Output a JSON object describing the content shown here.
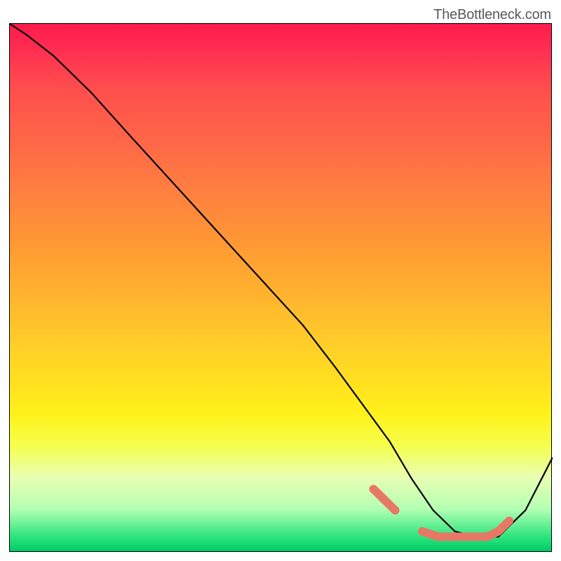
{
  "watermark": "TheBottleneck.com",
  "chart_data": {
    "type": "line",
    "title": "",
    "xlabel": "",
    "ylabel": "",
    "xlim": [
      0,
      100
    ],
    "ylim": [
      0,
      100
    ],
    "grid": false,
    "legend": false,
    "gradient_colors": {
      "top": "#ff1a4d",
      "mid_upper": "#ff8040",
      "mid": "#ffe01f",
      "mid_lower": "#e8ffb3",
      "bottom": "#00cc66"
    },
    "series": [
      {
        "name": "bottleneck-curve",
        "color": "#000000",
        "x": [
          0,
          3,
          8,
          15,
          22,
          30,
          38,
          46,
          54,
          60,
          65,
          70,
          74,
          78,
          82,
          86,
          90,
          95,
          100
        ],
        "y": [
          100,
          98,
          94,
          87,
          79,
          70,
          61,
          52,
          43,
          35,
          28,
          21,
          14,
          8,
          4,
          3,
          3,
          8,
          18
        ]
      },
      {
        "name": "highlight-dots",
        "color": "#e87866",
        "type": "scatter",
        "x": [
          67,
          69,
          71,
          76,
          79,
          82,
          84,
          86,
          88,
          90,
          92
        ],
        "y": [
          12,
          10,
          8,
          4,
          3,
          3,
          3,
          3,
          3,
          4,
          6
        ]
      }
    ]
  }
}
